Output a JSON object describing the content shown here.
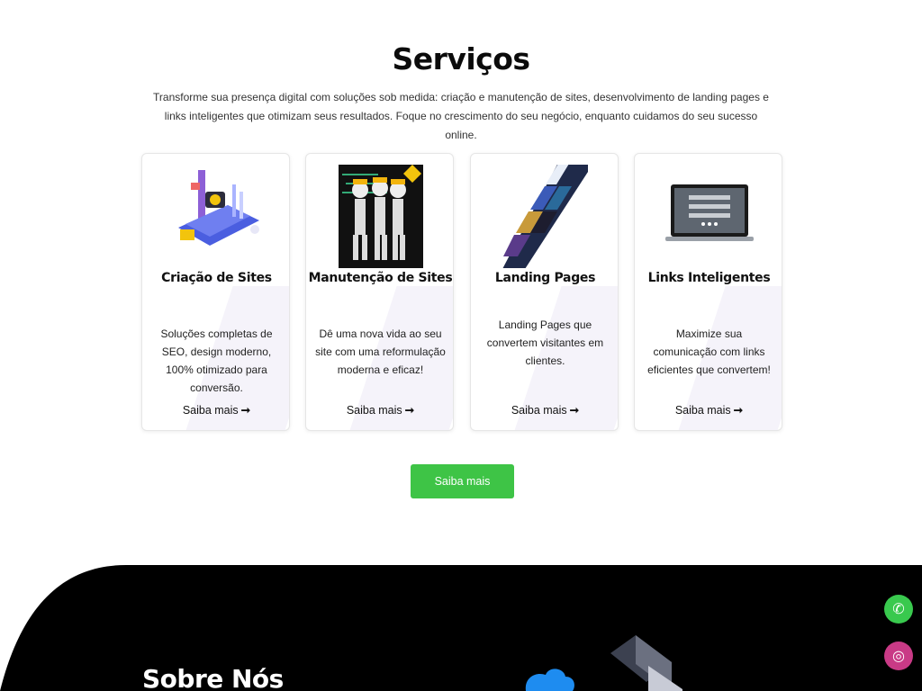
{
  "services": {
    "title": "Serviços",
    "subtitle": "Transforme sua presença digital com soluções sob medida: criação e manutenção de sites, desenvolvimento de landing pages e links inteligentes que otimizam seus resultados. Foque no crescimento do seu negócio, enquanto cuidamos do seu sucesso online.",
    "cards": [
      {
        "title": "Criação de Sites",
        "description": "Soluções completas de SEO, design moderno, 100% otimizado para conversão.",
        "link": "Saiba mais",
        "image_icon": "website-building-illustration"
      },
      {
        "title": "Manutenção de Sites",
        "description": "Dê uma nova vida ao seu site com uma reformulação moderna e eficaz!",
        "link": "Saiba mais",
        "image_icon": "maintenance-workers-illustration"
      },
      {
        "title": "Landing Pages",
        "description": "Landing Pages que convertem visitantes em clientes.",
        "link": "Saiba mais",
        "image_icon": "landing-page-mockups"
      },
      {
        "title": "Links Inteligentes",
        "description": "Maximize sua comunicação com links eficientes que convertem!",
        "link": "Saiba mais",
        "image_icon": "laptop-links-page"
      }
    ],
    "cta_label": "Saiba mais",
    "arrow_glyph": "➞"
  },
  "about": {
    "title": "Sobre Nós"
  },
  "floating": {
    "whatsapp_glyph": "✆",
    "instagram_glyph": "◎"
  },
  "colors": {
    "cta_green": "#3ec446",
    "whatsapp_green": "#39c94e",
    "instagram_pink": "#c93a86",
    "about_bg": "#000000"
  }
}
